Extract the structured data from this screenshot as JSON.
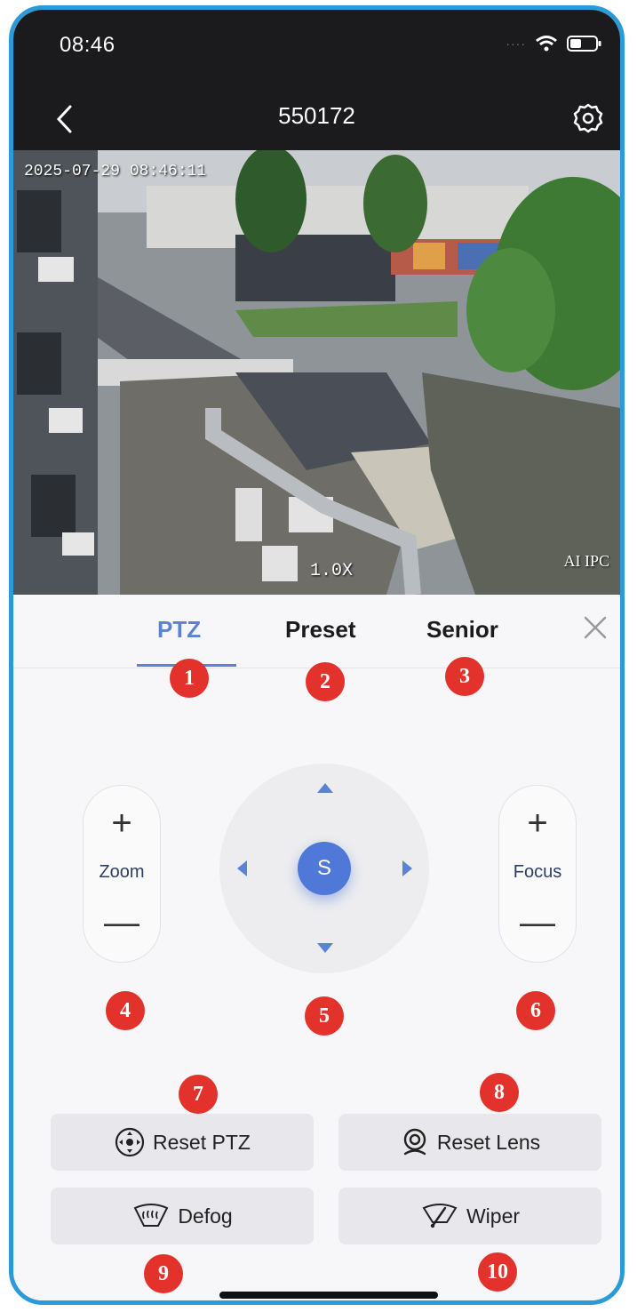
{
  "status": {
    "time": "08:46"
  },
  "nav": {
    "title": "550172"
  },
  "video": {
    "timestamp": "2025-07-29 08:46:11",
    "zoom_level": "1.0X",
    "overlay_label": "AI IPC"
  },
  "tabs": [
    {
      "label": "PTZ",
      "active": true
    },
    {
      "label": "Preset",
      "active": false
    },
    {
      "label": "Senior",
      "active": false
    }
  ],
  "zoom": {
    "label": "Zoom",
    "plus": "+",
    "minus": "—"
  },
  "focus": {
    "label": "Focus",
    "plus": "+",
    "minus": "—"
  },
  "dpad": {
    "center_label": "S"
  },
  "actions": {
    "reset_ptz": "Reset PTZ",
    "reset_lens": "Reset Lens",
    "defog": "Defog",
    "wiper": "Wiper"
  },
  "badges": [
    "1",
    "2",
    "3",
    "4",
    "5",
    "6",
    "7",
    "8",
    "9",
    "10"
  ],
  "colors": {
    "accent": "#5b82d6",
    "badge": "#e2322b",
    "frame": "#2a9ad8",
    "header": "#1b1b1d"
  },
  "icons": [
    "chevron-left-icon",
    "gear-icon",
    "wifi-icon",
    "battery-icon",
    "close-icon",
    "ptz-reset-icon",
    "lens-icon",
    "defog-icon",
    "wiper-icon"
  ]
}
